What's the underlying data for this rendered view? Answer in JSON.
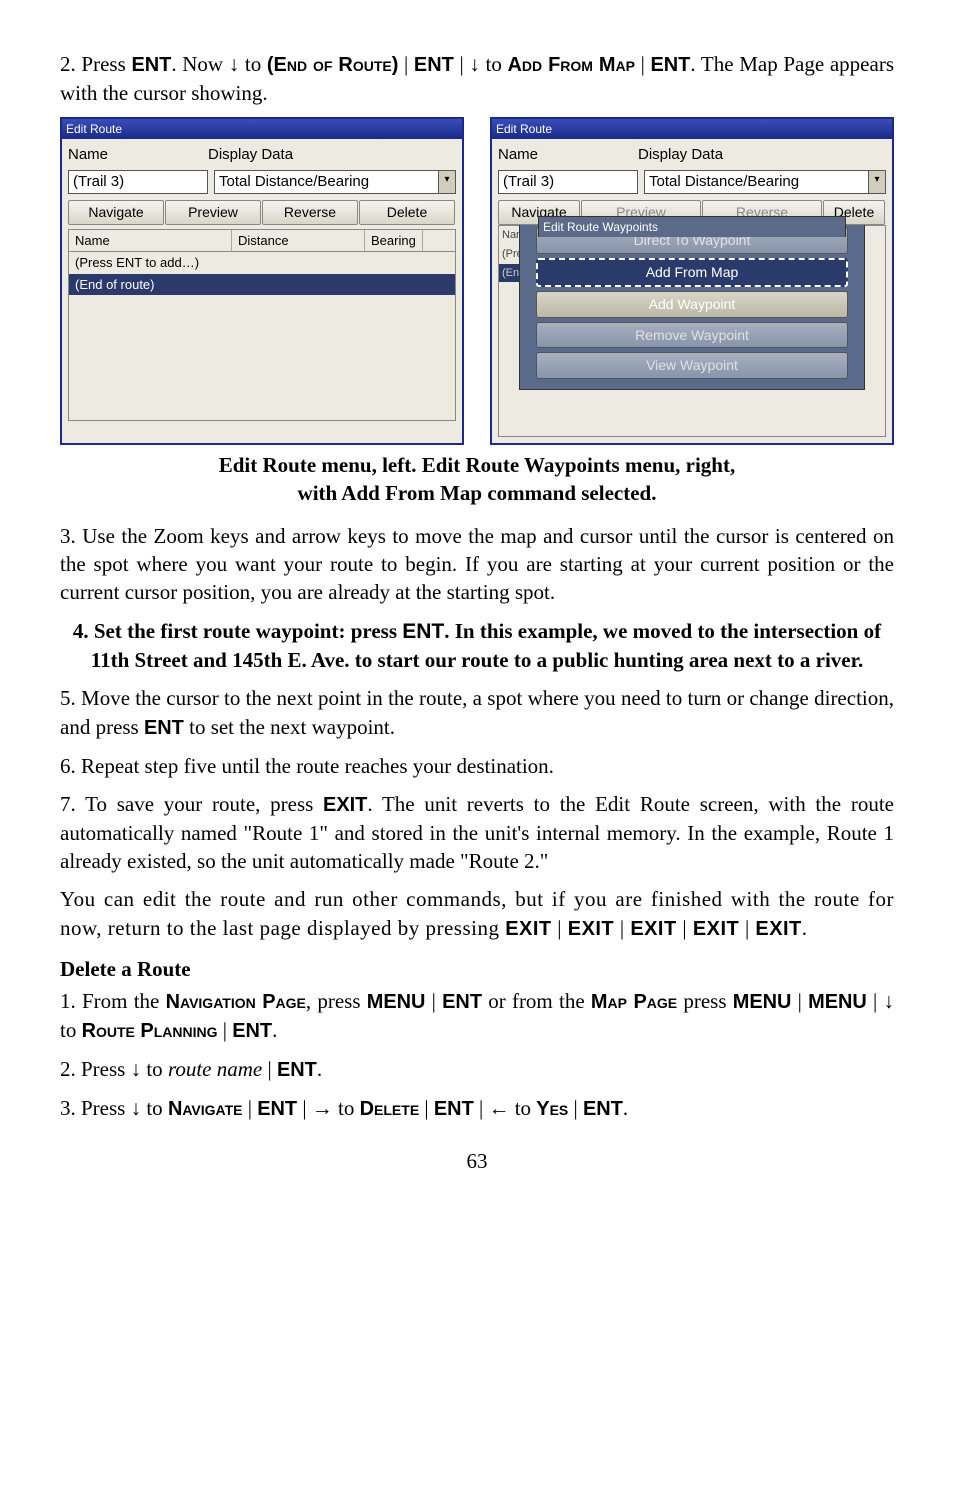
{
  "intro": {
    "prefix": "2. Press ",
    "ent": "ENT",
    "mid1": ". Now ↓ to ",
    "eor": "(End of Route)",
    "sep1": " | ",
    "mid2": " | ↓ to ",
    "afm": "Add From Map",
    "sep2": " | ",
    "suffix": ". The Map Page appears with the cursor showing."
  },
  "dialogL": {
    "title": "Edit Route",
    "nameLabel": "Name",
    "nameValue": "(Trail 3)",
    "dispLabel": "Display Data",
    "dispValue": "Total Distance/Bearing",
    "tabs": [
      "Navigate",
      "Preview",
      "Reverse",
      "Delete"
    ],
    "colName": "Name",
    "colDist": "Distance",
    "colBear": "Bearing",
    "row1": "(Press ENT to add…)",
    "row2": "(End of route)"
  },
  "dialogR": {
    "title": "Edit Route",
    "nameLabel": "Name",
    "nameValue": "(Trail 3)",
    "dispLabel": "Display Data",
    "dispValue": "Total Distance/Bearing",
    "navBtn": "Navigate",
    "deleteStub": "Delete",
    "previewStub": "Preview",
    "reverseStub": "Reverse",
    "popupTitle": "Edit Route Waypoints",
    "menu1": "Direct To Waypoint",
    "menu2": "Add From Map",
    "menu3": "Add Waypoint",
    "menu4": "Remove Waypoint",
    "menu5": "View Waypoint",
    "stubName": "Name",
    "stubPress": "(Press",
    "stubEnd": "(End"
  },
  "caption": {
    "line1": "Edit Route menu, left. Edit Route Waypoints menu, right,",
    "line2": "with Add From Map command selected."
  },
  "para3": "3. Use the Zoom keys and arrow keys to move the map and cursor until the cursor is centered on the spot where you want your route to begin. If you are starting at your current position or the current cursor position, you are already at the starting spot.",
  "subhead4": {
    "prefix": "4. Set the first route waypoint: press ",
    "ent": "ENT",
    "rest": ". In this example, we moved to the intersection of 11th Street and 145th E. Ave. to start our route to a public hunting area next to a river."
  },
  "para5": {
    "a": "5. Move the cursor to the next point in the route, a spot where you need to turn or change direction, and press ",
    "b": "ENT",
    "c": " to set the next waypoint."
  },
  "para6": "6. Repeat step five until the route reaches your destination.",
  "para7": {
    "a": "7. To save your route, press ",
    "b": "EXIT",
    "c": ". The unit reverts to the Edit Route screen, with the route automatically named \"Route 1\" and stored in the unit's internal memory. In the example, Route 1 already existed, so the unit automatically made \"Route 2.\""
  },
  "para8": {
    "a": "You can edit the route and run other commands, but if you are finished with the route for now, return to the last page displayed by pressing ",
    "b": "EXIT",
    "sep": " | "
  },
  "deleteRoute": "Delete a Route",
  "d1": {
    "a": "1. From the ",
    "b": "Navigation Page",
    "c": ", press ",
    "d": "MENU",
    "sep": " | ",
    "e": "ENT",
    "f": " or from the ",
    "g": "Map Page",
    "h": " press ",
    "i": " | ↓ to ",
    "j": "Route Planning",
    "k": "."
  },
  "d2": {
    "a": "2. Press ↓ to ",
    "b": "route name",
    "sep": " | ",
    "c": "ENT",
    "d": "."
  },
  "d3": {
    "a": "3. Press ↓ to ",
    "b": "Navigate",
    "sep": " | ",
    "c": "ENT",
    "d": " | → to ",
    "e": "Delete",
    "f": " | ← to ",
    "g": "Yes",
    "h": "."
  },
  "pageNum": "63"
}
